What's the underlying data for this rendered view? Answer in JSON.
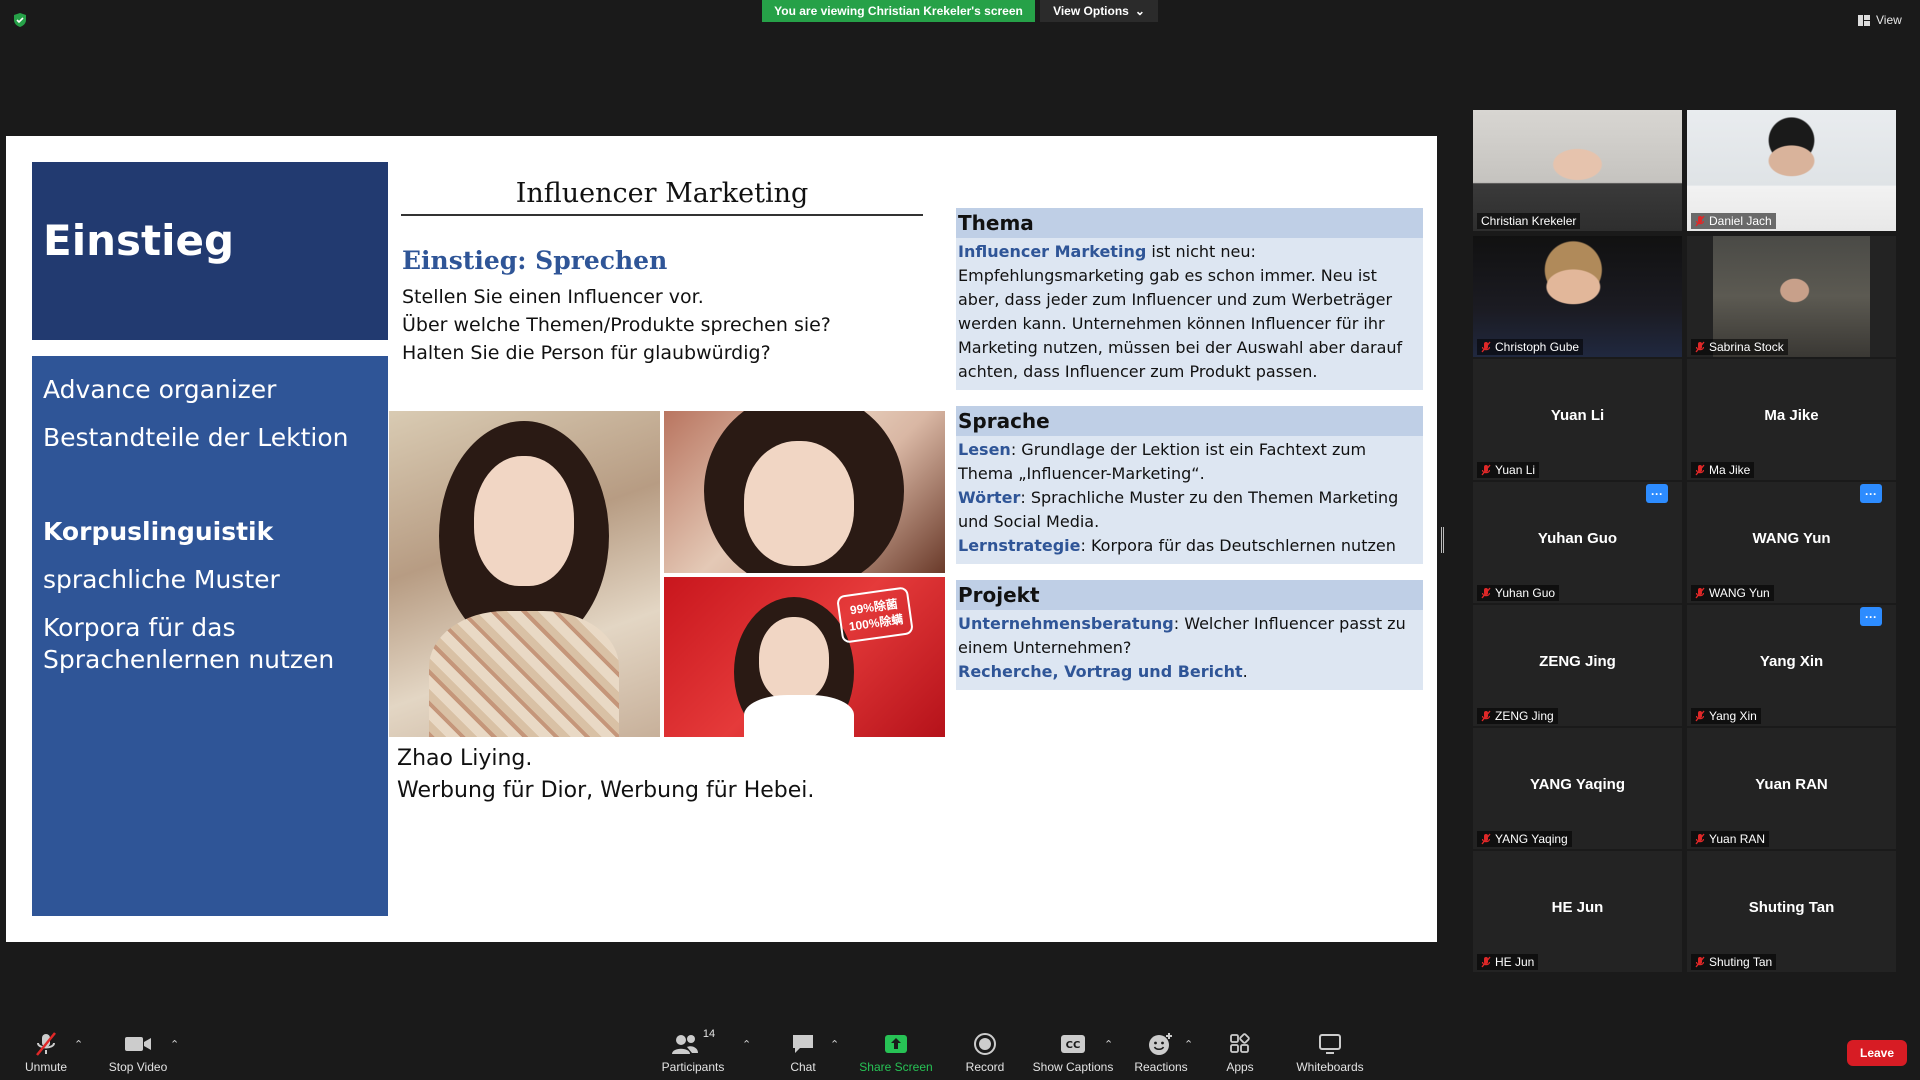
{
  "topbar": {
    "viewing_banner": "You are viewing Christian Krekeler's screen",
    "view_options": "View Options",
    "view_label": "View"
  },
  "slide": {
    "left_title": "Einstieg",
    "left_items": [
      "Advance organizer",
      "Bestandteile der Lektion",
      "Korpuslinguistik",
      "sprachliche Muster",
      "Korpora für das",
      "Sprachenlernen nutzen"
    ],
    "title": "Influencer Marketing",
    "subtitle": "Einstieg: Sprechen",
    "questions": [
      "Stellen Sie einen Influencer vor.",
      "Über welche Themen/Produkte sprechen sie?",
      "Halten Sie die Person für glaubwürdig?"
    ],
    "photo_stamp": "99%除菌 100%除螨",
    "caption_1": "Zhao Liying.",
    "caption_2": "Werbung für Dior, Werbung für Hebei.",
    "thema": {
      "heading": "Thema",
      "hl": "Influencer Marketing",
      "text": " ist nicht neu: Empfehlungsmarketing gab es schon immer. Neu ist aber, dass jeder zum Influencer und zum Werbeträger werden kann. Unternehmen können Influencer für ihr Marketing nutzen, müssen bei der Auswahl aber darauf achten, dass Influencer zum Produkt passen."
    },
    "sprache": {
      "heading": "Sprache",
      "lesen_hl": "Lesen",
      "lesen_text": ": Grundlage der Lektion ist ein Fachtext zum Thema „Influencer-Marketing“.",
      "woerter_hl": "Wörter",
      "woerter_text": ": Sprachliche Muster zu den Themen Marketing und Social Media.",
      "lern_hl": "Lernstrategie",
      "lern_text": ": Korpora für das Deutschlernen nutzen"
    },
    "projekt": {
      "heading": "Projekt",
      "ub_hl": "Unternehmensberatung",
      "ub_text": ": Welcher Influencer passt zu einem Unternehmen?",
      "rvb_hl": "Recherche, Vortrag und Bericht",
      "rvb_text": "."
    }
  },
  "participants": [
    {
      "name": "Christian Krekeler",
      "video": true,
      "muted": false,
      "active": true
    },
    {
      "name": "Daniel Jach",
      "video": true,
      "muted": true
    },
    {
      "name": "Christoph Gube",
      "video": true,
      "muted": true
    },
    {
      "name": "Sabrina Stock",
      "video": true,
      "muted": true
    },
    {
      "name": "Yuan Li",
      "video": false,
      "muted": true
    },
    {
      "name": "Ma Jike",
      "video": false,
      "muted": true
    },
    {
      "name": "Yuhan Guo",
      "video": false,
      "muted": true,
      "more": true
    },
    {
      "name": "WANG Yun",
      "video": false,
      "muted": true,
      "more": true
    },
    {
      "name": "ZENG Jing",
      "video": false,
      "muted": true
    },
    {
      "name": "Yang Xin",
      "video": false,
      "muted": true,
      "more": true
    },
    {
      "name": "YANG Yaqing",
      "video": false,
      "muted": true
    },
    {
      "name": "Yuan RAN",
      "video": false,
      "muted": true
    },
    {
      "name": "HE Jun",
      "video": false,
      "muted": true
    },
    {
      "name": "Shuting Tan",
      "video": false,
      "muted": true
    }
  ],
  "more_label": "···",
  "toolbar": {
    "unmute": "Unmute",
    "stop_video": "Stop Video",
    "participants": "Participants",
    "participants_count": "14",
    "chat": "Chat",
    "share_screen": "Share Screen",
    "record": "Record",
    "show_captions": "Show Captions",
    "reactions": "Reactions",
    "apps": "Apps",
    "whiteboards": "Whiteboards",
    "leave": "Leave"
  },
  "colors": {
    "banner_green": "#26a148",
    "active_speaker": "#c9e265",
    "leave_red": "#d71c24",
    "slide_dark_blue": "#223a70",
    "slide_blue": "#2f5597"
  }
}
